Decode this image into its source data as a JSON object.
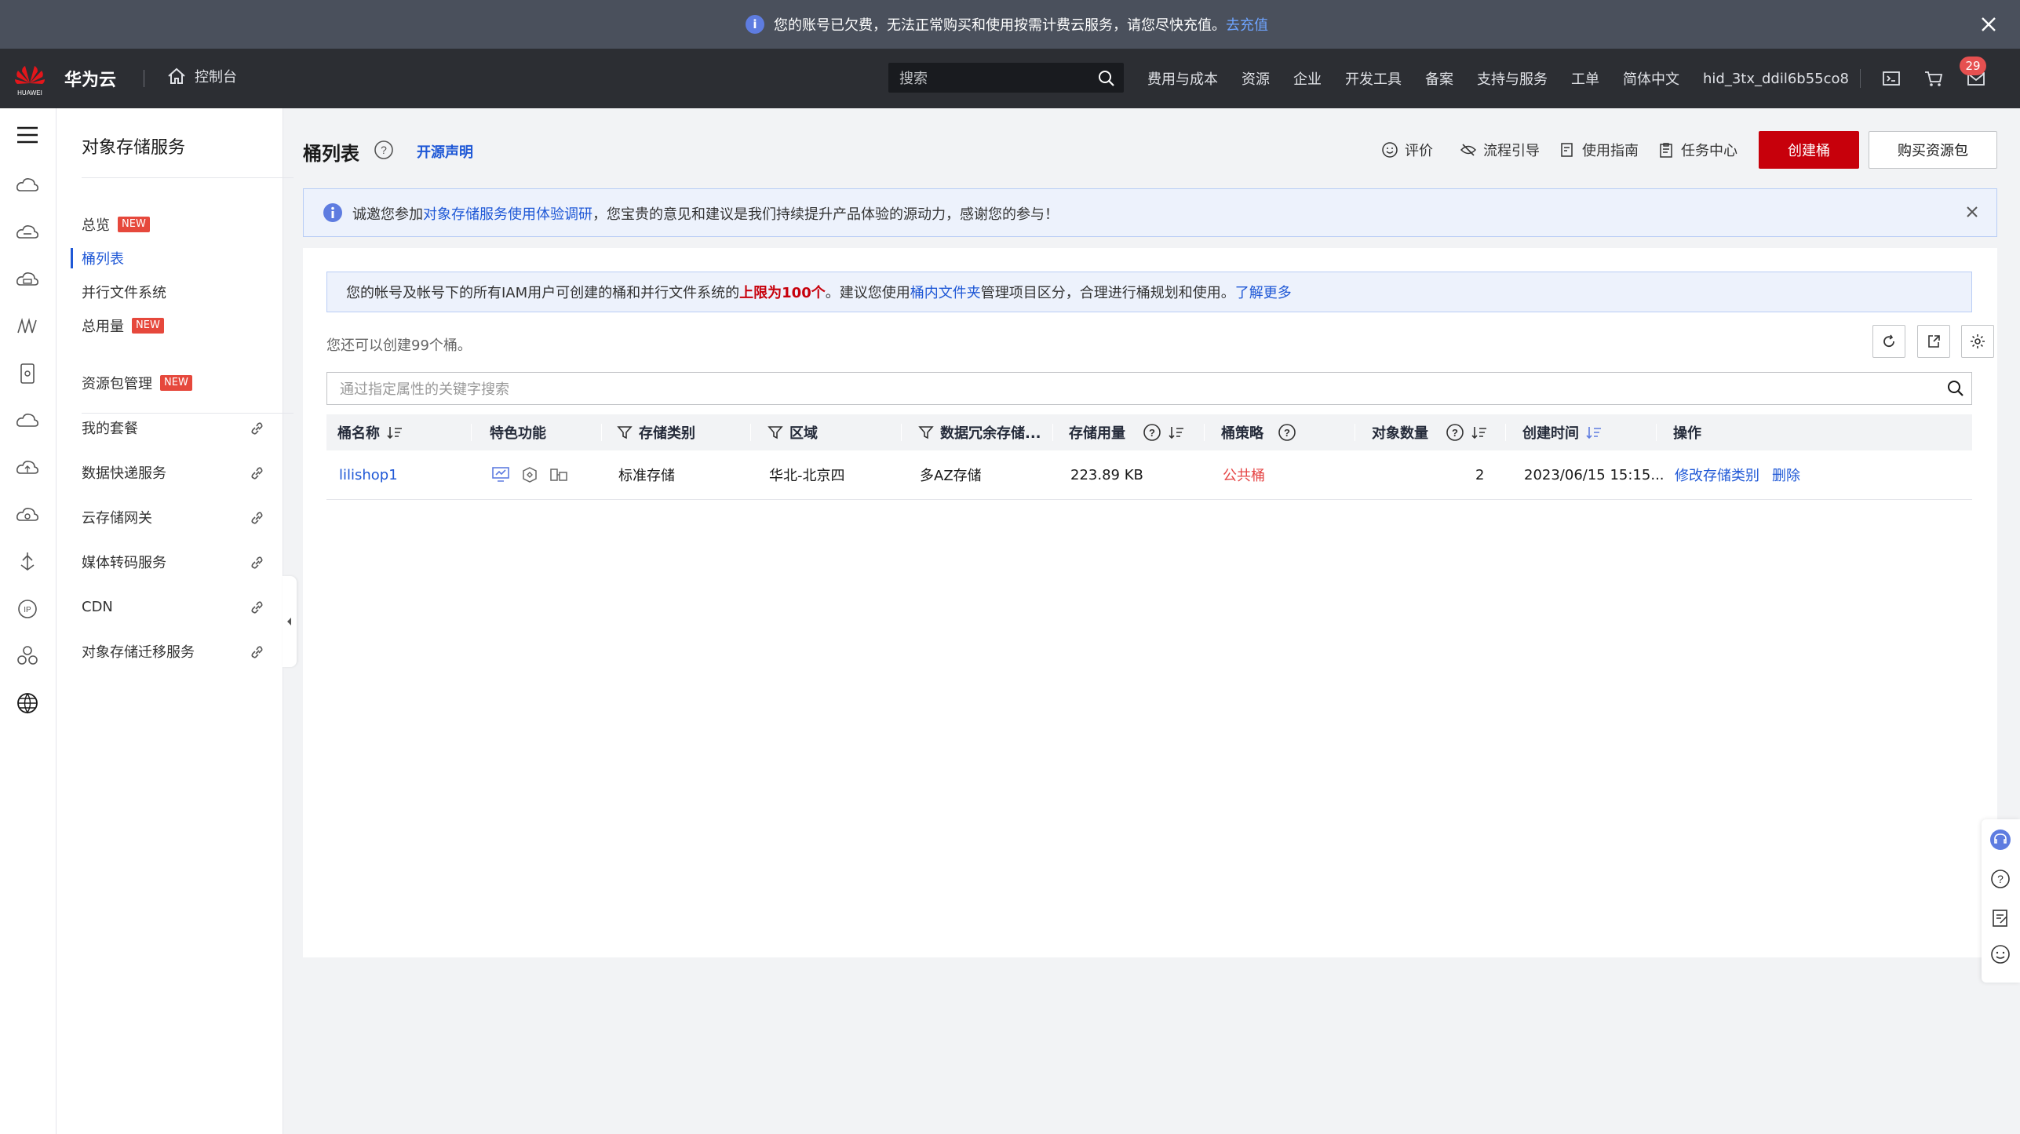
{
  "notice": {
    "text": "您的账号已欠费，无法正常购买和使用按需计费云服务，请您尽快充值。",
    "link": "去充值"
  },
  "header": {
    "brand": "华为云",
    "logo_text": "HUAWEI",
    "console": "控制台",
    "search_placeholder": "搜索",
    "nav": [
      "费用与成本",
      "资源",
      "企业",
      "开发工具",
      "备案",
      "支持与服务",
      "工单",
      "简体中文",
      "hid_3tx_ddil6b55co8"
    ],
    "mail_count": "29"
  },
  "sidebar": {
    "title": "对象存储服务",
    "items": [
      {
        "label": "总览",
        "tag": "NEW"
      },
      {
        "label": "桶列表"
      },
      {
        "label": "并行文件系统"
      },
      {
        "label": "总用量",
        "tag": "NEW"
      },
      {
        "label": "资源包管理",
        "tag": "NEW"
      }
    ],
    "links": [
      "我的套餐",
      "数据快递服务",
      "云存储网关",
      "媒体转码服务",
      "CDN",
      "对象存储迁移服务"
    ]
  },
  "main": {
    "title": "桶列表",
    "open_source": "开源声明",
    "tools": [
      "评价",
      "流程引导",
      "使用指南",
      "任务中心"
    ],
    "create_button": "创建桶",
    "buy_button": "购买资源包",
    "survey": {
      "prefix": "诚邀您参加",
      "link": "对象存储服务使用体验调研",
      "suffix": "，您宝贵的意见和建议是我们持续提升产品体验的源动力，感谢您的参与！"
    },
    "limit": {
      "prefix": "您的帐号及帐号下的所有IAM用户可创建的桶和并行文件系统的",
      "highlight": "上限为100个",
      "middle": "。建议您使用",
      "link1": "桶内文件夹",
      "suffix": "管理项目区分，合理进行桶规划和使用。",
      "link2": "了解更多"
    },
    "remaining": "您还可以创建99个桶。",
    "filter_placeholder": "通过指定属性的关键字搜索",
    "columns": [
      "桶名称",
      "特色功能",
      "存储类别",
      "区域",
      "数据冗余存储...",
      "存储用量",
      "桶策略",
      "对象数量",
      "创建时间",
      "操作"
    ],
    "rows": [
      {
        "name": "lilishop1",
        "storage_class": "标准存储",
        "region": "华北-北京四",
        "redundancy": "多AZ存储",
        "usage": "223.89 KB",
        "policy": "公共桶",
        "objects": "2",
        "created": "2023/06/15 15:15...",
        "action1": "修改存储类别",
        "action2": "删除"
      }
    ]
  },
  "colors": {
    "accent_red": "#c7000b",
    "link_blue": "#1f58d6",
    "header_bg": "#2c2e33",
    "notice_bg": "#4a505c"
  }
}
